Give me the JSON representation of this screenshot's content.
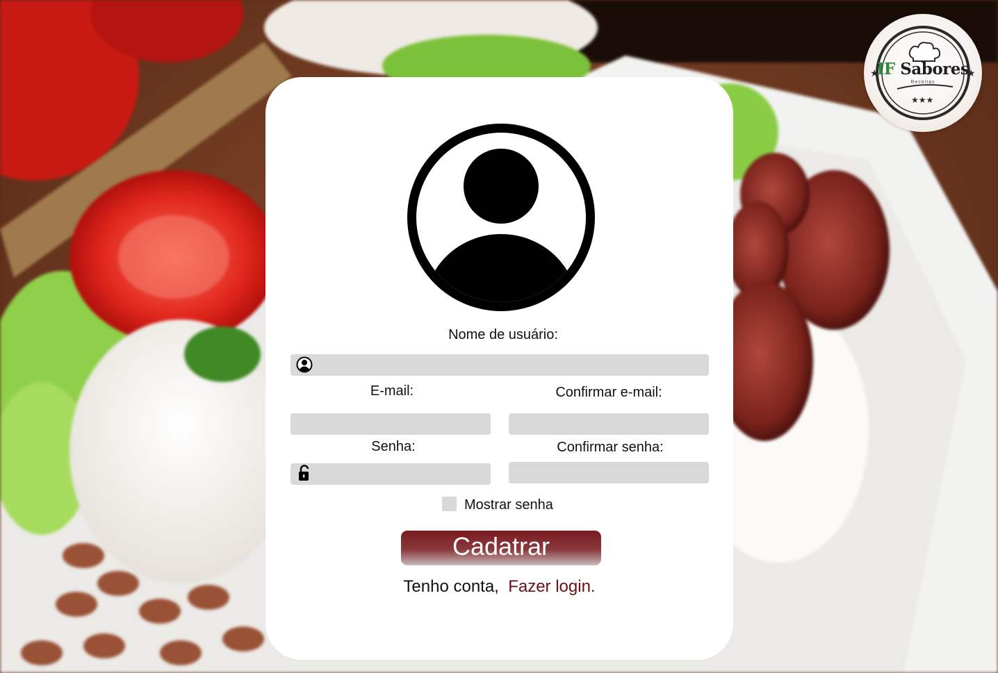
{
  "brand": {
    "logo_primary": "IF",
    "logo_name": "Sabores",
    "logo_tagline": "Receitas"
  },
  "form": {
    "username_label": "Nome de usuário:",
    "email_label": "E-mail:",
    "confirm_email_label": "Confirmar e-mail:",
    "password_label": "Senha:",
    "confirm_password_label": "Confirmar senha:",
    "username_value": "",
    "email_value": "",
    "confirm_email_value": "",
    "password_value": "",
    "confirm_password_value": "",
    "show_password_label": "Mostrar senha",
    "show_password_checked": false,
    "submit_label": "Cadatrar"
  },
  "footer": {
    "have_account_text": "Tenho conta,",
    "login_link_text": "Fazer login."
  },
  "colors": {
    "card_bg": "#ffffff",
    "field_bg": "#d9d9d9",
    "button_top": "#7a1a1f",
    "link": "#6b0f14"
  },
  "icons": {
    "avatar": "user-circle-icon",
    "username_field": "user-circle-icon",
    "password_field": "lock-open-icon"
  }
}
